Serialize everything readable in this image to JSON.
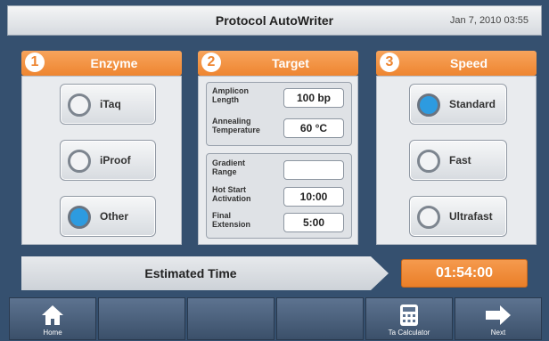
{
  "app": {
    "title": "Protocol AutoWriter",
    "date": "Jan 7, 2010 03:55"
  },
  "colors": {
    "accent": "#ee8530",
    "selected": "#2d9be0",
    "background": "#35506f"
  },
  "enzyme": {
    "number": "1",
    "title": "Enzyme",
    "options": [
      {
        "label": "iTaq",
        "selected": false
      },
      {
        "label": "iProof",
        "selected": false
      },
      {
        "label": "Other",
        "selected": true
      }
    ]
  },
  "target": {
    "number": "2",
    "title": "Target",
    "amplicon_length": {
      "label_line1": "Amplicon",
      "label_line2": "Length",
      "value": "100 bp"
    },
    "annealing_temp": {
      "label_line1": "Annealing",
      "label_line2": "Temperature",
      "value": "60 °C"
    },
    "gradient_range": {
      "label_line1": "Gradient",
      "label_line2": "Range",
      "value": ""
    },
    "hot_start": {
      "label_line1": "Hot Start",
      "label_line2": "Activation",
      "value": "10:00"
    },
    "final_extension": {
      "label_line1": "Final",
      "label_line2": "Extension",
      "value": "5:00"
    }
  },
  "speed": {
    "number": "3",
    "title": "Speed",
    "options": [
      {
        "label": "Standard",
        "selected": true
      },
      {
        "label": "Fast",
        "selected": false
      },
      {
        "label": "Ultrafast",
        "selected": false
      }
    ]
  },
  "estimate": {
    "label": "Estimated Time",
    "value": "01:54:00"
  },
  "toolbar": {
    "home_label": "Home",
    "ta_calc_label": "Ta Calculator",
    "next_label": "Next",
    "icons": [
      "home-icon",
      "calculator-icon",
      "arrow-right-icon"
    ]
  }
}
